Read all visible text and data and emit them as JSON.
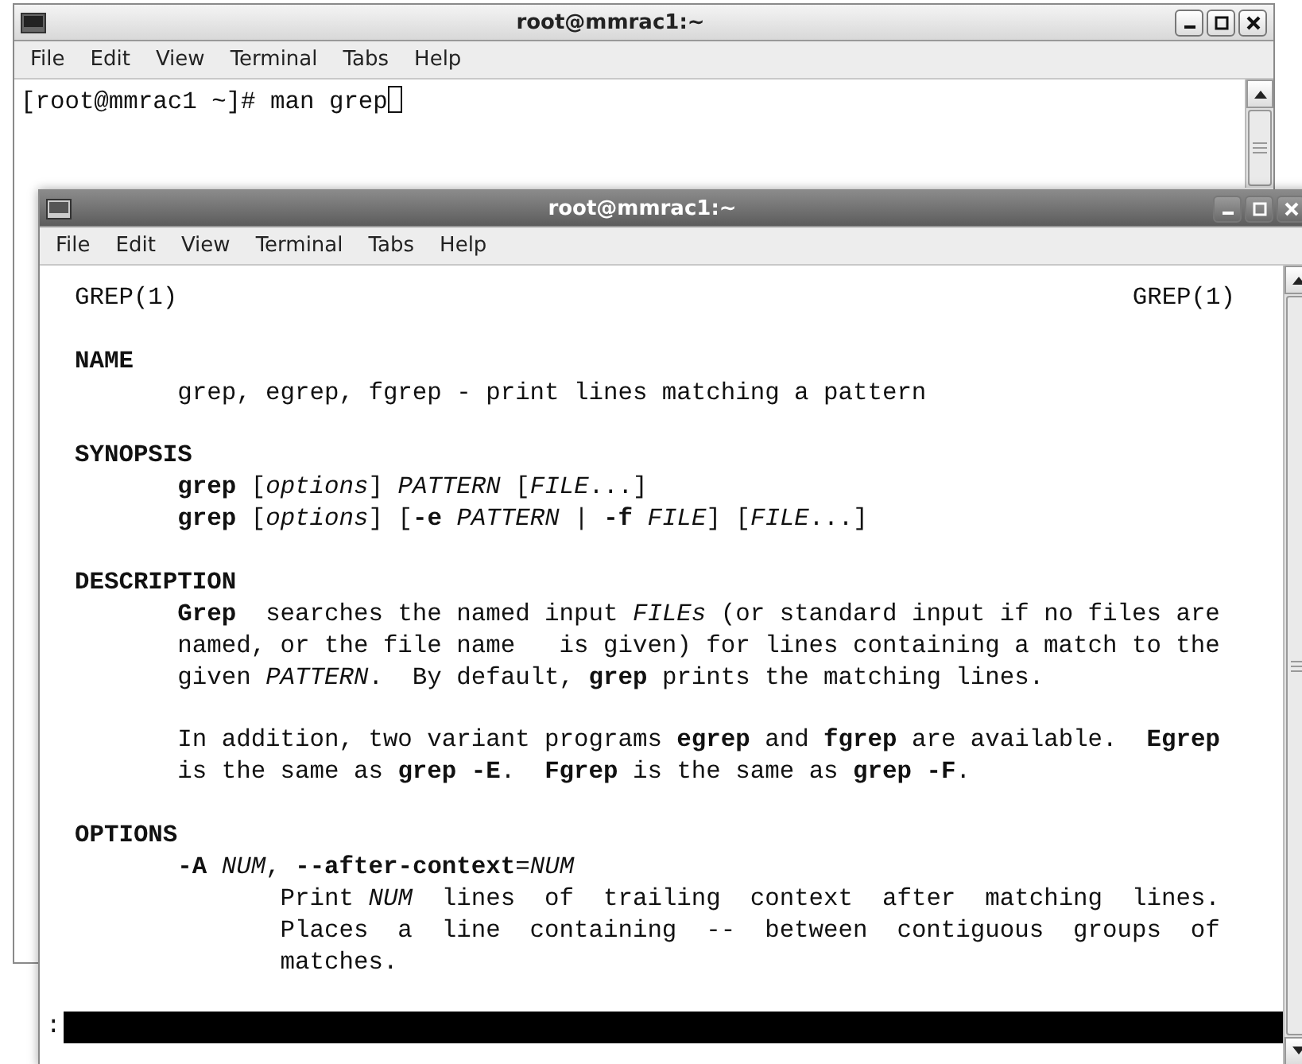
{
  "windows": [
    {
      "title": "root@mmrac1:~",
      "active": false,
      "menu": [
        "File",
        "Edit",
        "View",
        "Terminal",
        "Tabs",
        "Help"
      ],
      "lines": [
        {
          "kind": "command",
          "text": "[root@mmrac1 ~]# man grep"
        }
      ]
    },
    {
      "title": "root@mmrac1:~",
      "active": true,
      "menu": [
        "File",
        "Edit",
        "View",
        "Terminal",
        "Tabs",
        "Help"
      ],
      "lines": [
        {
          "kind": "header",
          "left": "GREP(1)",
          "right": "GREP(1)"
        },
        {
          "kind": "blank"
        },
        {
          "kind": "heading",
          "text": "NAME"
        },
        {
          "kind": "body",
          "text": "grep, egrep, fgrep - print lines matching a pattern"
        },
        {
          "kind": "blank"
        },
        {
          "kind": "heading",
          "text": "SYNOPSIS"
        },
        {
          "kind": "body",
          "text": "**grep** [*options*] *PATTERN* [*FILE*...]"
        },
        {
          "kind": "body",
          "text": "**grep** [*options*] [**-e** *PATTERN* | **-f** *FILE*] [*FILE*...]"
        },
        {
          "kind": "blank"
        },
        {
          "kind": "heading",
          "text": "DESCRIPTION"
        },
        {
          "kind": "body",
          "text": "**Grep**  searches the named input *FILEs* (or standard input if no files are"
        },
        {
          "kind": "body",
          "text": "named, or the file name   is given) for lines containing a match to the"
        },
        {
          "kind": "body",
          "text": "given *PATTERN*.  By default, **grep** prints the matching lines."
        },
        {
          "kind": "blank"
        },
        {
          "kind": "body",
          "text": "In addition, two variant programs **egrep** and **fgrep** are available.  **Egrep**"
        },
        {
          "kind": "body",
          "text": "is the same as **grep -E**.  **Fgrep** is the same as **grep -F**."
        },
        {
          "kind": "blank"
        },
        {
          "kind": "heading",
          "text": "OPTIONS"
        },
        {
          "kind": "body",
          "text": "**-A** *NUM*, **--after-context**=*NUM*"
        },
        {
          "kind": "detail",
          "text": "Print *NUM*  lines  of  trailing  context  after  matching  lines."
        },
        {
          "kind": "detail",
          "text": "Places  a  line  containing  --  between  contiguous  groups  of"
        },
        {
          "kind": "detail",
          "text": "matches."
        },
        {
          "kind": "blank"
        },
        {
          "kind": "prompt",
          "text": ":"
        }
      ]
    }
  ]
}
